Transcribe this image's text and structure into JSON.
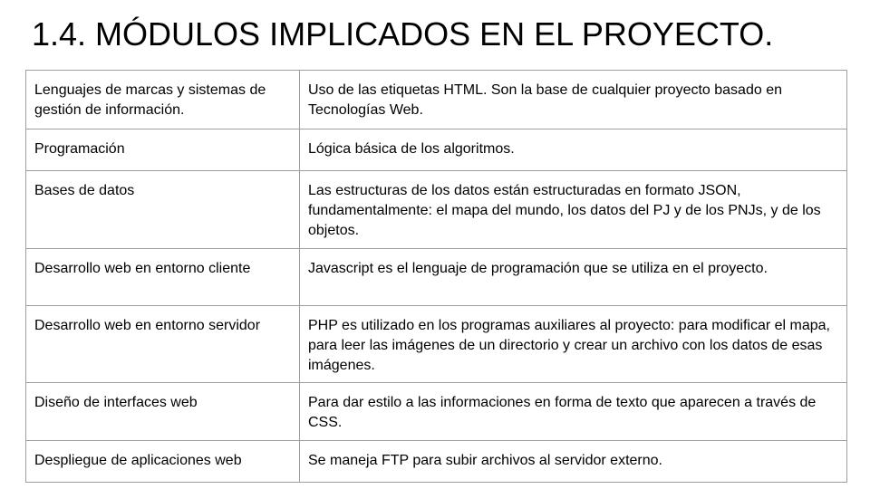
{
  "slide": {
    "title": "1.4. MÓDULOS IMPLICADOS EN EL PROYECTO."
  },
  "table": {
    "rows": [
      {
        "module": "Lenguajes de marcas y sistemas de gestión de información.",
        "description": "Uso de las etiquetas HTML. Son la base de cualquier proyecto basado en Tecnologías Web."
      },
      {
        "module": "Programación",
        "description": "Lógica básica de los algoritmos."
      },
      {
        "module": "Bases de datos",
        "description": "Las estructuras de los datos están estructuradas en formato JSON, fundamentalmente: el mapa del mundo, los datos del PJ y de los PNJs, y de los objetos."
      },
      {
        "module": "Desarrollo web en entorno cliente",
        "description": "Javascript es el lenguaje de programación que se utiliza en el proyecto."
      },
      {
        "module": "Desarrollo web en entorno servidor",
        "description": "PHP es utilizado en los programas auxiliares al proyecto: para modificar el mapa, para leer las imágenes de un directorio y crear un archivo con los datos de esas imágenes."
      },
      {
        "module": "Diseño de interfaces web",
        "description": "Para dar estilo a las informaciones en forma de texto que aparecen a través de CSS."
      },
      {
        "module": "Despliegue de aplicaciones web",
        "description": "Se maneja FTP para subir archivos al servidor externo."
      }
    ]
  }
}
